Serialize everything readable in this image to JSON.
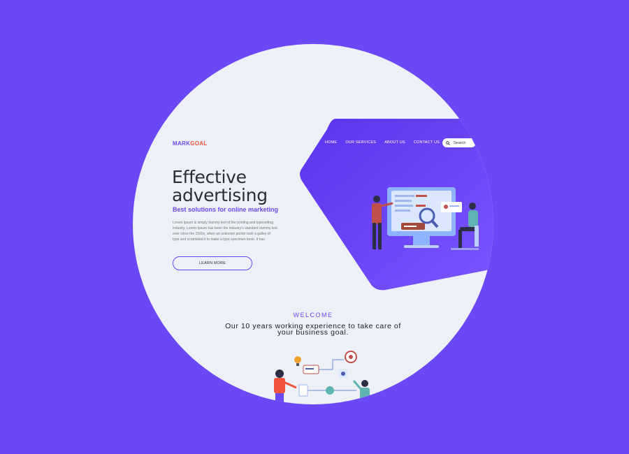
{
  "brand": {
    "part1": "MARK",
    "part2": "GOAL"
  },
  "nav": {
    "items": [
      "HOME",
      "OUR SERVICES",
      "ABOUT US",
      "CONTACT US"
    ],
    "search_label": "Search"
  },
  "hero": {
    "headline_line1": "Effective",
    "headline_line2": "advertising",
    "subhead": "Best solutions for online marketing",
    "body": "Lorem Ipsum is simply dummy text of the printing and typesetting industry. Lorem Ipsum has been the industry's standard dummy text ever since the 1500s, when an unknown printer took a galley of type and scrambled it to make a type specimen book. It has",
    "cta_label": "LEARN MORE"
  },
  "welcome": {
    "title": "WELCOME",
    "tagline_line1": "Our 10 years working experience to take care of",
    "tagline_line2": "your business goal."
  },
  "colors": {
    "background": "#6c47f5",
    "accent": "#6c47f5",
    "logo_accent": "#f0523a",
    "page": "#eef0f8"
  }
}
